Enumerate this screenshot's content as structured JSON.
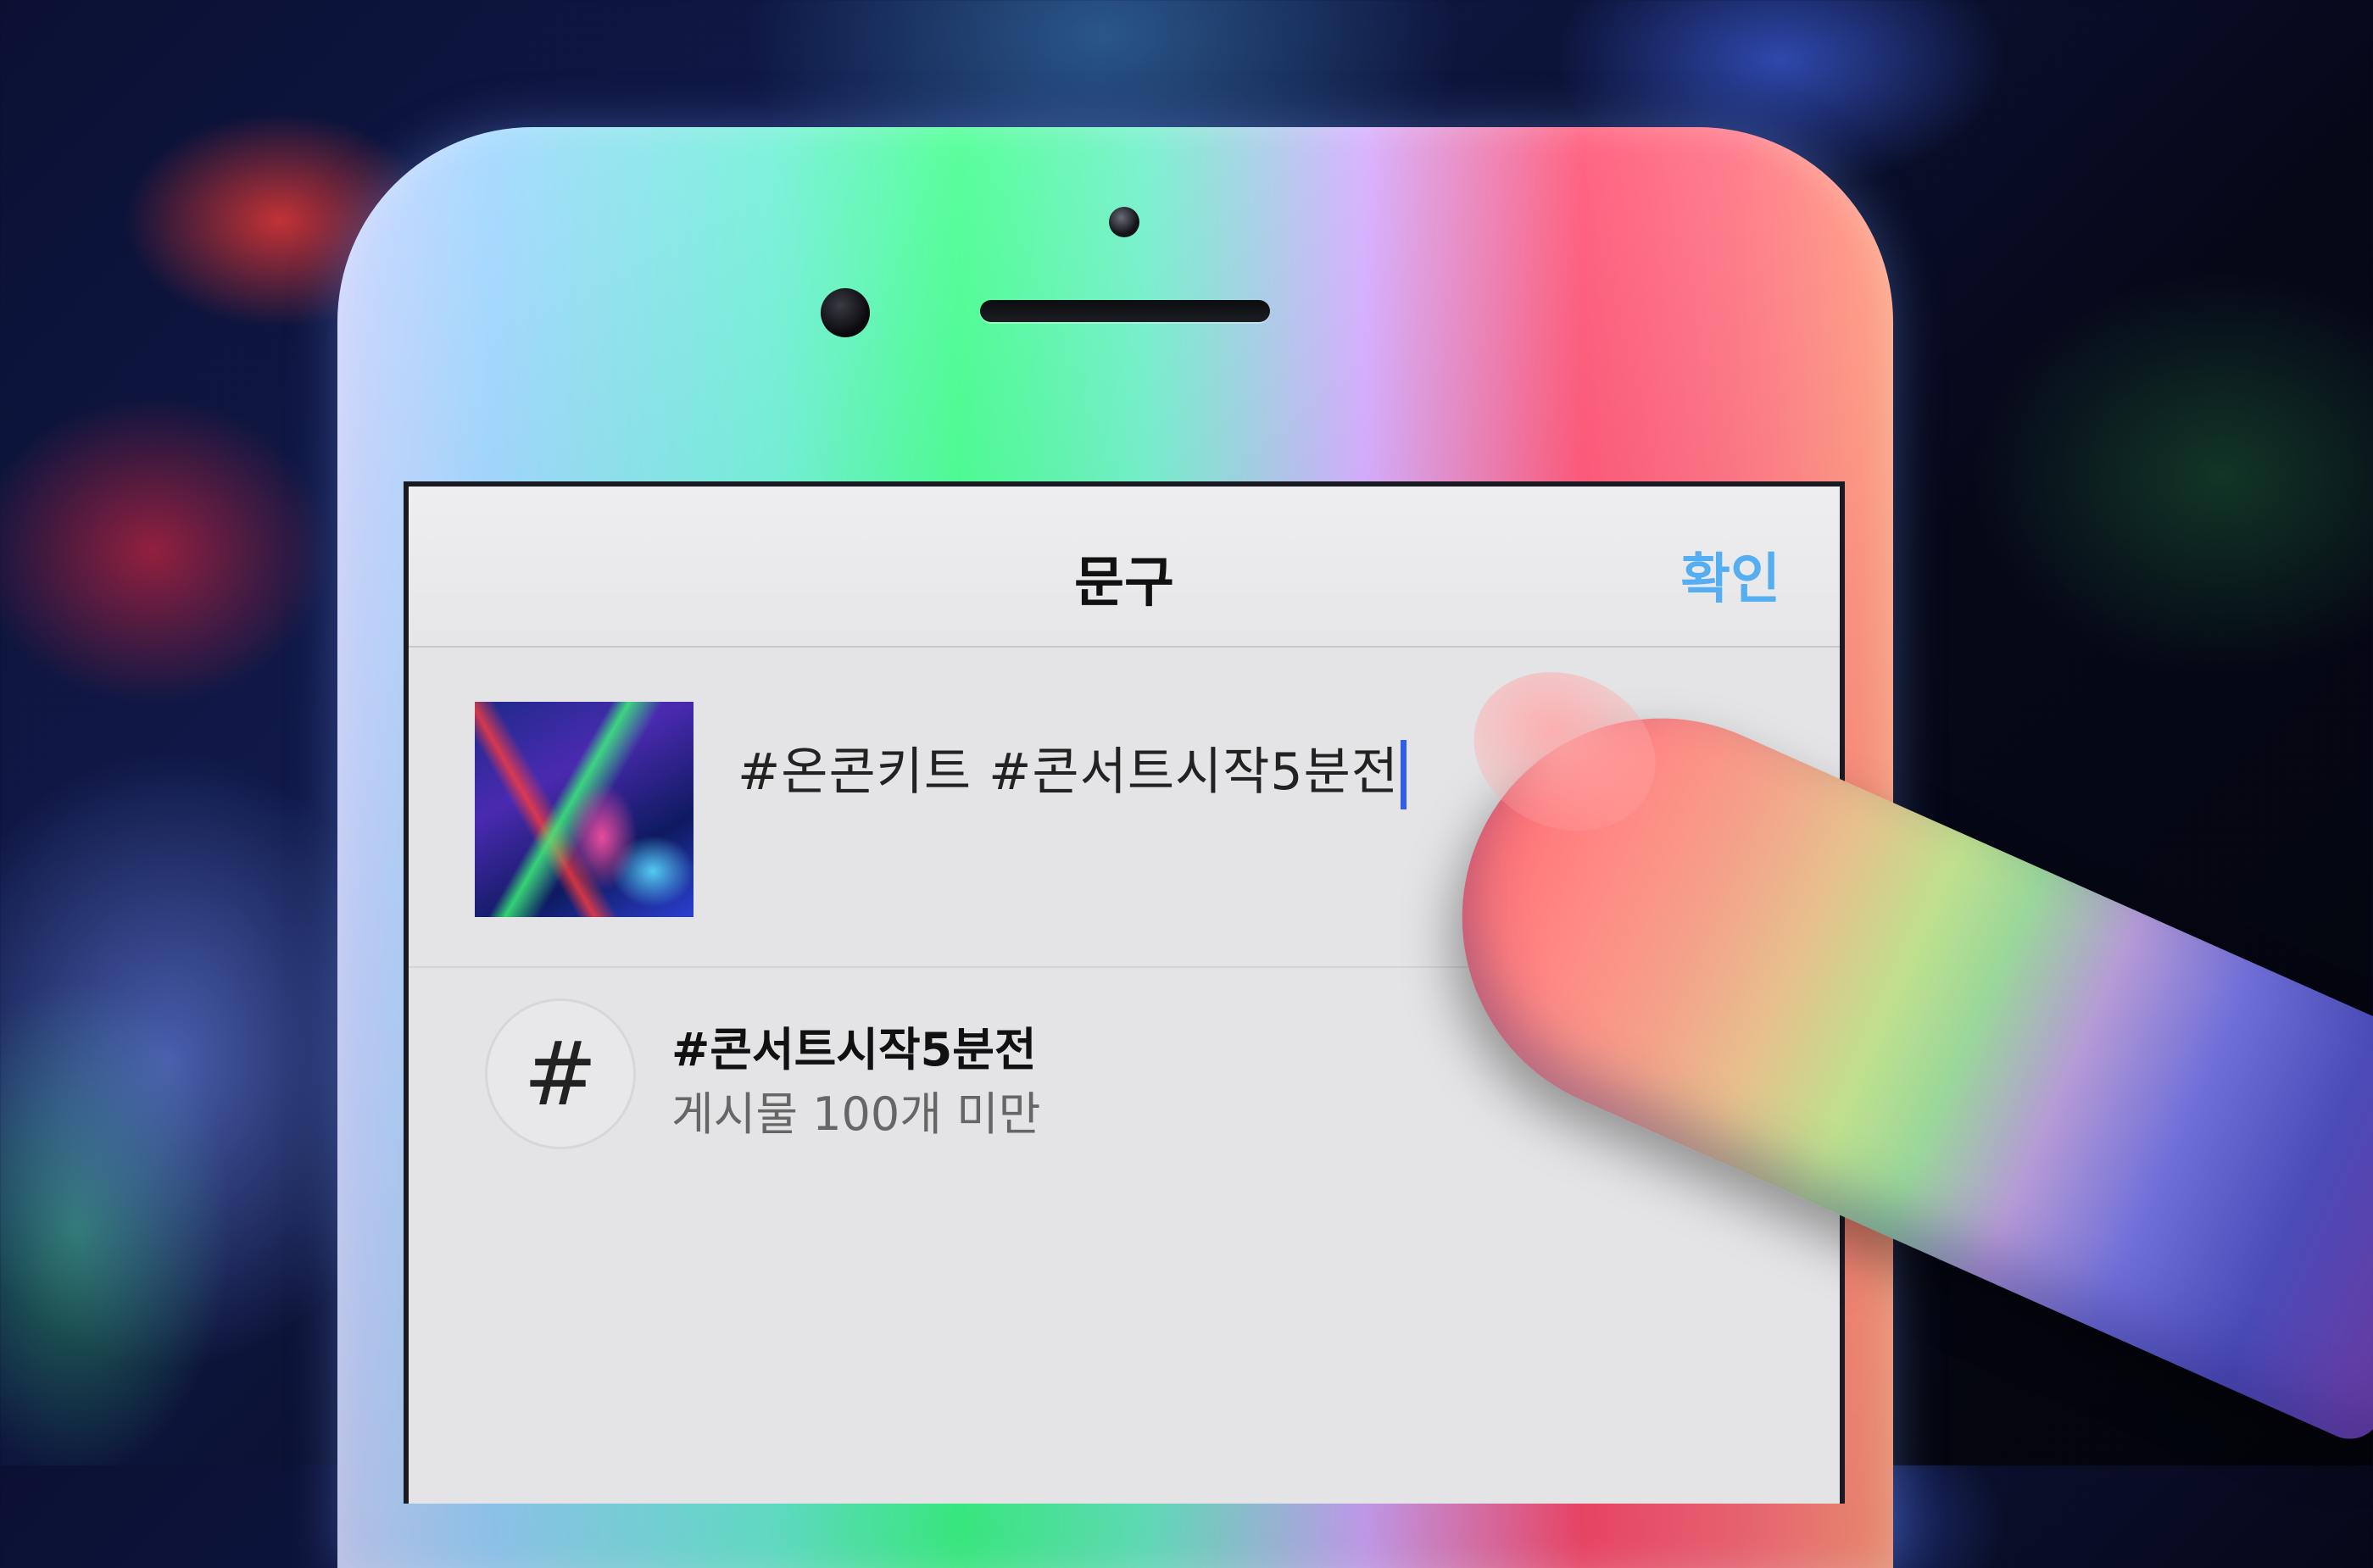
{
  "nav": {
    "title": "문구",
    "confirm_label": "확인"
  },
  "caption": {
    "text": "#온콘키트 #콘서트시작5분전"
  },
  "hashtag_suggestion": {
    "icon_symbol": "#",
    "name": "#콘서트시작5분전",
    "post_count": "게시물 100개 미만"
  },
  "colors": {
    "accent": "#56aef2",
    "cursor": "#2f5fe8"
  }
}
